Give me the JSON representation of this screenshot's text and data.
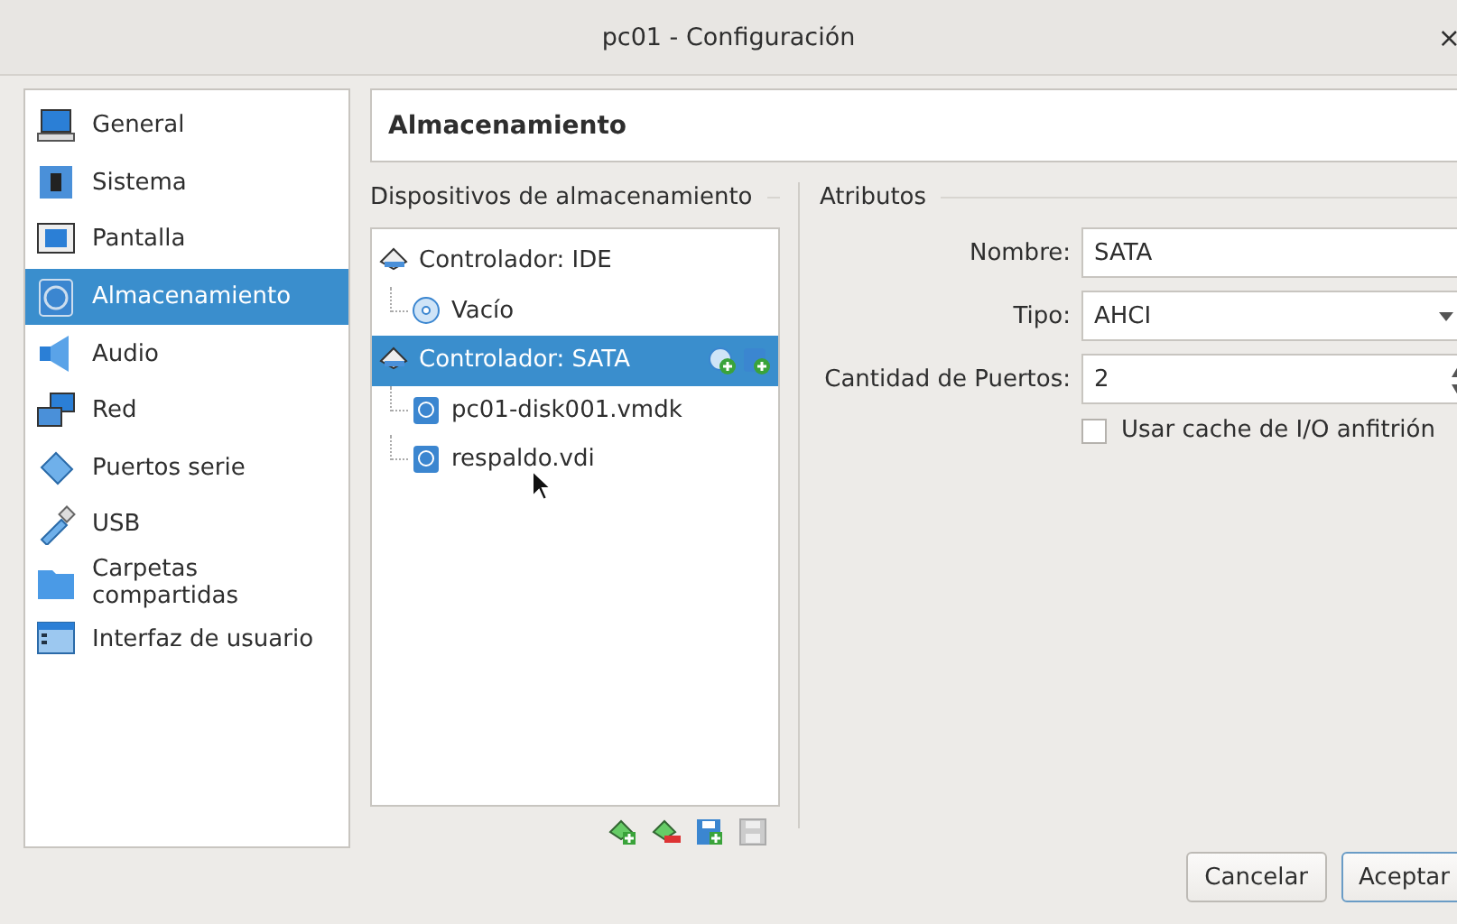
{
  "window": {
    "title": "pc01 - Configuración",
    "close": "×"
  },
  "sidebar": {
    "items": [
      {
        "label": "General",
        "kind": "general",
        "selected": false
      },
      {
        "label": "Sistema",
        "kind": "system",
        "selected": false
      },
      {
        "label": "Pantalla",
        "kind": "display",
        "selected": false
      },
      {
        "label": "Almacenamiento",
        "kind": "storage",
        "selected": true
      },
      {
        "label": "Audio",
        "kind": "audio",
        "selected": false
      },
      {
        "label": "Red",
        "kind": "network",
        "selected": false
      },
      {
        "label": "Puertos serie",
        "kind": "serial",
        "selected": false
      },
      {
        "label": "USB",
        "kind": "usb",
        "selected": false
      },
      {
        "label": "Carpetas compartidas",
        "kind": "folder",
        "selected": false
      },
      {
        "label": "Interfaz de usuario",
        "kind": "ui",
        "selected": false
      }
    ]
  },
  "page_title": "Almacenamiento",
  "storage_devices": {
    "title": "Dispositivos de almacenamiento",
    "tree": [
      {
        "label": "Controlador: IDE",
        "kind": "controller",
        "selected": false,
        "children": [
          {
            "label": "Vacío",
            "kind": "optical",
            "selected": false
          }
        ]
      },
      {
        "label": "Controlador: SATA",
        "kind": "controller",
        "selected": true,
        "children": [
          {
            "label": "pc01-disk001.vmdk",
            "kind": "disk",
            "selected": false
          },
          {
            "label": "respaldo.vdi",
            "kind": "disk",
            "selected": false
          }
        ]
      }
    ]
  },
  "attributes": {
    "title": "Atributos",
    "name": {
      "label": "Nombre:",
      "value": "SATA"
    },
    "type": {
      "label": "Tipo:",
      "value": "AHCI"
    },
    "port_count": {
      "label": "Cantidad de Puertos:",
      "value": "2"
    },
    "host_cache": {
      "label": "Usar cache de I/O anfitrión",
      "checked": false
    }
  },
  "buttons": [
    {
      "label": "Cancelar",
      "default": false
    },
    {
      "label": "Aceptar",
      "default": true
    }
  ]
}
